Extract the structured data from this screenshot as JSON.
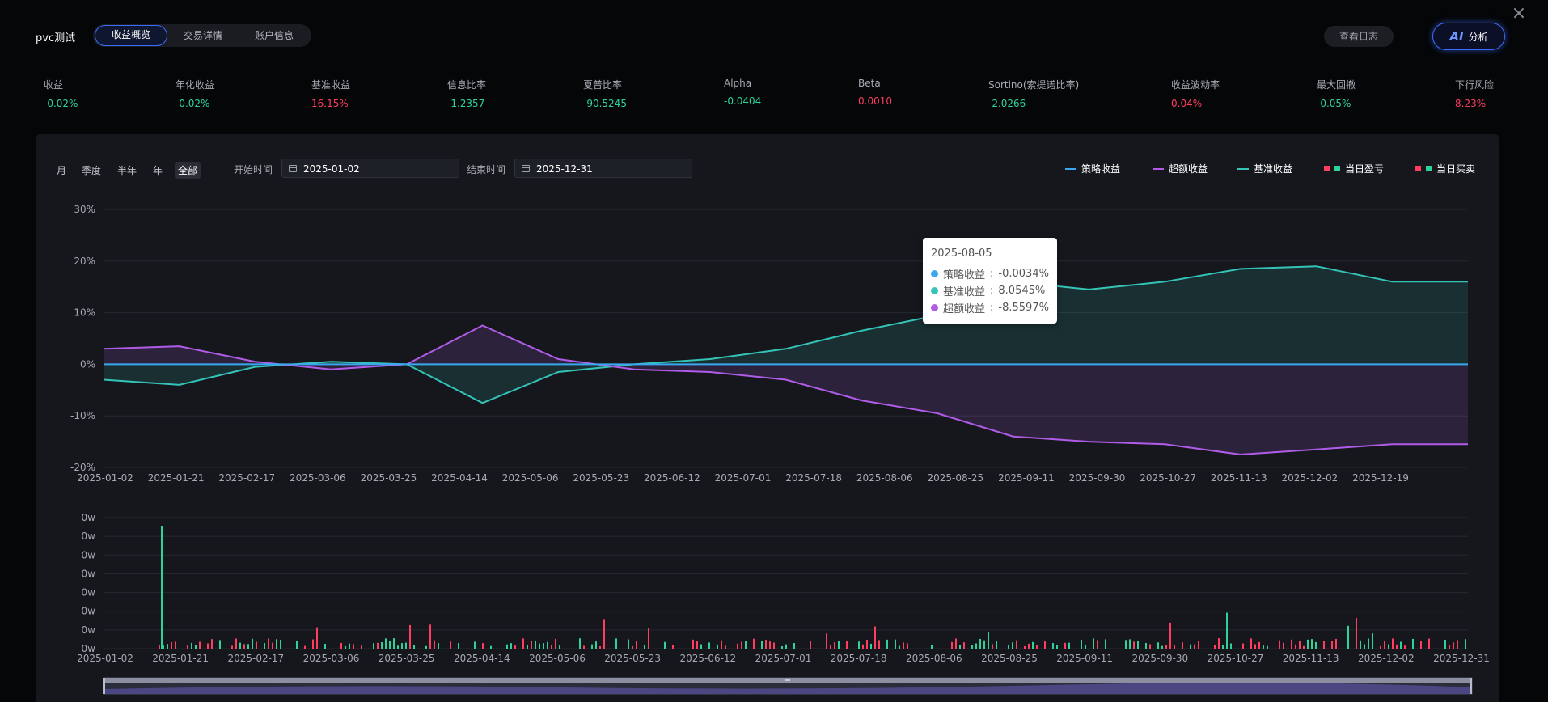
{
  "app_title": "pvc测试",
  "tabs": [
    {
      "label": "收益概览",
      "active": true
    },
    {
      "label": "交易详情",
      "active": false
    },
    {
      "label": "账户信息",
      "active": false
    }
  ],
  "log_button": "查看日志",
  "ai_button": {
    "logo": "AI",
    "label": "分析"
  },
  "close_icon": "×",
  "metrics": [
    {
      "label": "收益",
      "value": "-0.02%",
      "tone": "green"
    },
    {
      "label": "年化收益",
      "value": "-0.02%",
      "tone": "green"
    },
    {
      "label": "基准收益",
      "value": "16.15%",
      "tone": "red"
    },
    {
      "label": "信息比率",
      "value": "-1.2357",
      "tone": "green"
    },
    {
      "label": "夏普比率",
      "value": "-90.5245",
      "tone": "green"
    },
    {
      "label": "Alpha",
      "value": "-0.0404",
      "tone": "green"
    },
    {
      "label": "Beta",
      "value": "0.0010",
      "tone": "red"
    },
    {
      "label": "Sortino(索提诺比率)",
      "value": "-2.0266",
      "tone": "green"
    },
    {
      "label": "收益波动率",
      "value": "0.04%",
      "tone": "red"
    },
    {
      "label": "最大回撤",
      "value": "-0.05%",
      "tone": "green"
    },
    {
      "label": "下行风险",
      "value": "8.23%",
      "tone": "red"
    }
  ],
  "periods": [
    "月",
    "季度",
    "半年",
    "年",
    "全部"
  ],
  "active_period": "全部",
  "date_range": {
    "start_label": "开始时间",
    "start": "2025-01-02",
    "end_label": "结束时间",
    "end": "2025-12-31"
  },
  "legend": [
    {
      "label": "策略收益",
      "kind": "line",
      "color": "#3aa8f0"
    },
    {
      "label": "超额收益",
      "kind": "line",
      "color": "#b05ce8"
    },
    {
      "label": "基准收益",
      "kind": "line",
      "color": "#34c4b7"
    },
    {
      "label": "当日盈亏",
      "kind": "squares",
      "colors": [
        "#ff3d5f",
        "#2fd39a"
      ]
    },
    {
      "label": "当日买卖",
      "kind": "squares",
      "colors": [
        "#ff3d5f",
        "#2fd39a"
      ]
    }
  ],
  "tooltip": {
    "date": "2025-08-05",
    "rows": [
      {
        "label": "策略收益",
        "value": "-0.0034%",
        "color": "#3aa8f0"
      },
      {
        "label": "基准收益",
        "value": "8.0545%",
        "color": "#34c4b7"
      },
      {
        "label": "超额收益",
        "value": "-8.5597%",
        "color": "#b05ce8"
      }
    ]
  },
  "chart_data": [
    {
      "type": "line",
      "x_tick_labels": [
        "2025-01-02",
        "2025-01-21",
        "2025-02-17",
        "2025-03-06",
        "2025-03-25",
        "2025-04-14",
        "2025-05-06",
        "2025-05-23",
        "2025-06-12",
        "2025-07-01",
        "2025-07-18",
        "2025-08-06",
        "2025-08-25",
        "2025-09-11",
        "2025-09-30",
        "2025-10-27",
        "2025-11-13",
        "2025-12-02",
        "2025-12-19"
      ],
      "y_tick_labels": [
        "30%",
        "20%",
        "10%",
        "0%",
        "-10%",
        "-20%"
      ],
      "ylim": [
        -20,
        30
      ],
      "series": [
        {
          "name": "策略收益",
          "color": "#3aa8f0",
          "values": [
            0,
            0,
            0,
            0,
            0,
            0,
            0,
            0,
            0,
            0,
            0,
            0,
            0,
            0,
            0,
            0,
            0,
            0,
            0
          ]
        },
        {
          "name": "基准收益",
          "color": "#34c4b7",
          "values": [
            -3,
            -4,
            -0.5,
            0.5,
            0,
            -7.5,
            -1.5,
            0,
            1,
            3,
            6.5,
            9.5,
            16,
            14.5,
            16,
            18.5,
            19,
            16,
            16
          ]
        },
        {
          "name": "超额收益",
          "color": "#b05ce8",
          "values": [
            3,
            3.5,
            0.5,
            -1,
            0,
            7.5,
            1,
            -1,
            -1.5,
            -3,
            -7,
            -9.5,
            -14,
            -15,
            -15.5,
            -17.5,
            -16.5,
            -15.5,
            -15.5
          ]
        }
      ]
    },
    {
      "type": "bar",
      "x_tick_labels": [
        "2025-01-02",
        "2025-01-21",
        "2025-02-17",
        "2025-03-06",
        "2025-03-25",
        "2025-04-14",
        "2025-05-06",
        "2025-05-23",
        "2025-06-12",
        "2025-07-01",
        "2025-07-18",
        "2025-08-06",
        "2025-08-25",
        "2025-09-11",
        "2025-09-30",
        "2025-10-27",
        "2025-11-13",
        "2025-12-02",
        "2025-12-31"
      ],
      "y_tick_labels": [
        "0w",
        "0w",
        "0w",
        "0w",
        "0w",
        "0w",
        "0w",
        "0w"
      ],
      "series": [
        {
          "name": "当日盈亏",
          "colors": [
            "#ff3d5f",
            "#2fd39a"
          ]
        }
      ]
    }
  ]
}
